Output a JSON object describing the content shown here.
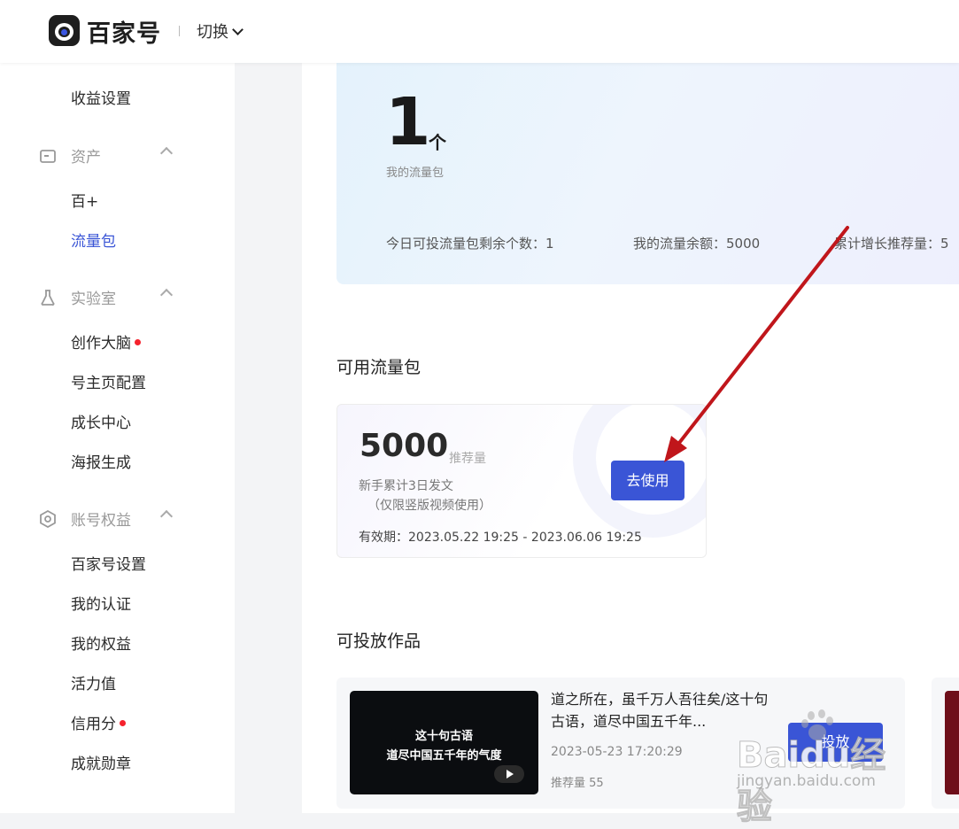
{
  "header": {
    "logo_text": "百家号",
    "switch_label": "切换"
  },
  "sidebar": {
    "income_settings": "收益设置",
    "groups": {
      "assets": {
        "label": "资产",
        "items": [
          "百+",
          "流量包"
        ]
      },
      "lab": {
        "label": "实验室",
        "items": [
          "创作大脑",
          "号主页配置",
          "成长中心",
          "海报生成"
        ]
      },
      "account": {
        "label": "账号权益",
        "items": [
          "百家号设置",
          "我的认证",
          "我的权益",
          "活力值",
          "信用分",
          "成就勋章"
        ]
      }
    },
    "active_item": "流量包"
  },
  "hero": {
    "count": "1",
    "unit": "个",
    "subtitle": "我的流量包",
    "stat_remaining": "今日可投流量包剩余个数：1",
    "stat_balance": "我的流量余额：5000",
    "stat_total": "累计增长推荐量：5"
  },
  "available": {
    "title": "可用流量包",
    "value": "5000",
    "value_unit": "推荐量",
    "desc": "新手累计3日发文",
    "note": "（仅限竖版视频使用）",
    "validity": "有效期：2023.05.22 19:25 - 2023.06.06 19:25",
    "use_button": "去使用"
  },
  "works": {
    "title": "可投放作品",
    "items": [
      {
        "thumb_line1": "这十句古语",
        "thumb_line2": "道尽中国五千年的气度",
        "title": "道之所在，虽千万人吾往矣/这十句古语，道尽中国五千年...",
        "date": "2023-05-23 17:20:29",
        "recommend": "推荐量 55",
        "button": "投放"
      }
    ]
  },
  "watermark": {
    "brand": "Baidu经验",
    "site": "jingyan.baidu.com"
  },
  "colors": {
    "accent": "#3a55d6",
    "annotation_arrow": "#c0161b",
    "notify_dot": "#f5222d"
  }
}
